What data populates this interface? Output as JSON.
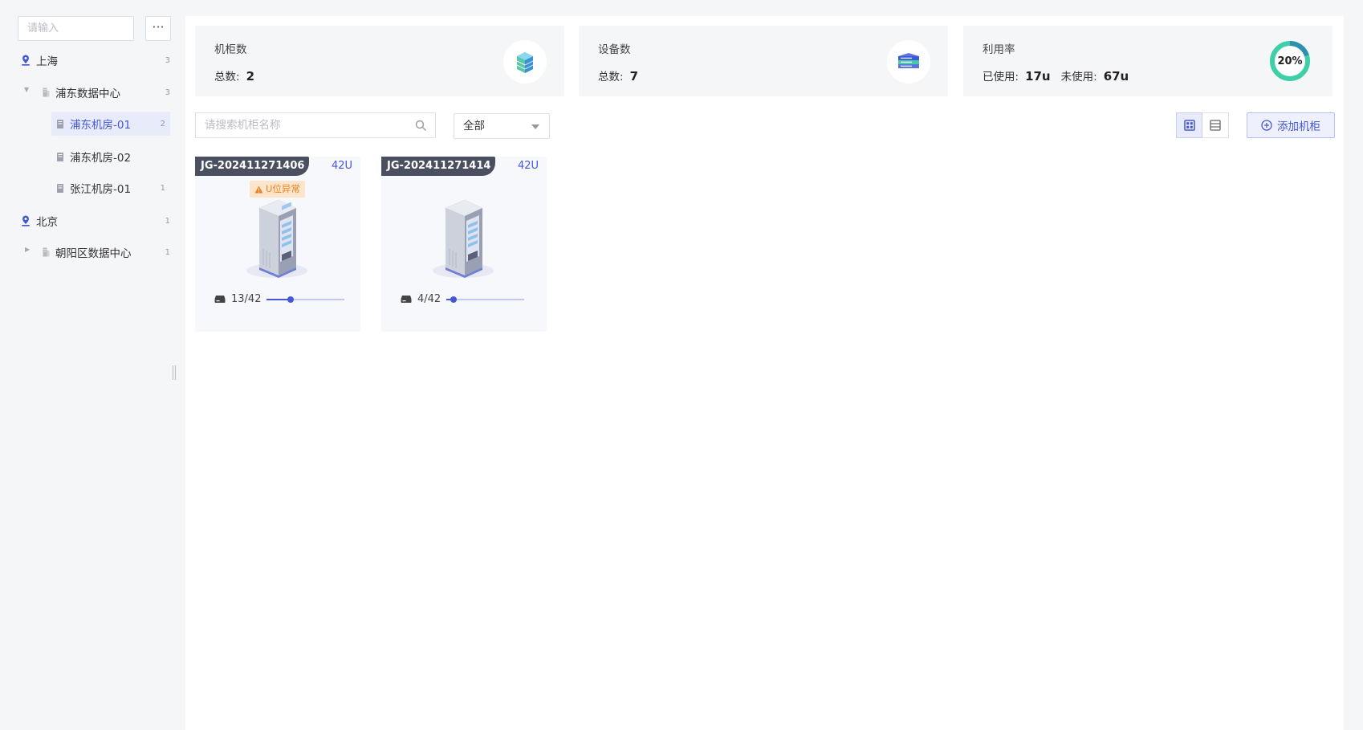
{
  "sidebar": {
    "search_placeholder": "请输入",
    "more_label": "···",
    "tree": [
      {
        "label": "上海",
        "count": "3"
      },
      {
        "label": "浦东数据中心",
        "count": "3"
      },
      {
        "label": "浦东机房-01",
        "count": "2"
      },
      {
        "label": "浦东机房-02",
        "count": ""
      },
      {
        "label": "张江机房-01",
        "count": "1"
      },
      {
        "label": "北京",
        "count": "1"
      },
      {
        "label": "朝阳区数据中心",
        "count": "1"
      }
    ]
  },
  "stats": {
    "cabinets": {
      "title": "机柜数",
      "total_label": "总数:",
      "total_value": "2"
    },
    "devices": {
      "title": "设备数",
      "total_label": "总数:",
      "total_value": "7"
    },
    "utilization": {
      "title": "利用率",
      "used_label": "已使用:",
      "used_value": "17u",
      "unused_label": "未使用:",
      "unused_value": "67u",
      "percent_label": "20%",
      "percent": 0.2
    }
  },
  "toolbar": {
    "search_placeholder": "请搜索机柜名称",
    "filter_value": "全部",
    "add_label": "添加机柜"
  },
  "cabinets": [
    {
      "name": "JG-202411271406",
      "units": "42U",
      "badge": "U位异常",
      "usage": "13/42",
      "fraction": 0.3095
    },
    {
      "name": "JG-202411271414",
      "units": "42U",
      "badge": "",
      "usage": "4/42",
      "fraction": 0.0952
    }
  ],
  "colors": {
    "accent": "#4458d6",
    "donut": "#3fcfa8",
    "warning": "#e8821f",
    "cabinet_header": "#4a5060"
  }
}
